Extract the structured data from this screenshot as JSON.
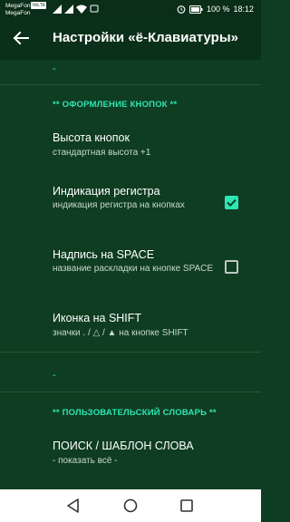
{
  "status_bar": {
    "carrier_1": "MegaFon",
    "carrier_1_badge": "VoLTE",
    "carrier_2": "MegaFon",
    "battery": "100 %",
    "time": "18:12"
  },
  "toolbar": {
    "title": "Настройки «ё-Клавиатуры»"
  },
  "content": {
    "top_dash": "-",
    "section_buttons": {
      "title": "** ОФОРМЛЕНИЕ КНОПОК **",
      "items": [
        {
          "title": "Высота кнопок",
          "summary": "стандартная высота +1"
        },
        {
          "title": "Индикация регистра",
          "summary": "индикация регистра на кнопках",
          "checked": true
        },
        {
          "title": "Надпись на SPACE",
          "summary": "название раскладки на кнопке SPACE",
          "checked": false
        },
        {
          "title": "Иконка на SHIFT",
          "summary": "значки . / △ / ▲ на кнопке SHIFT"
        }
      ]
    },
    "middle_dash": "-",
    "section_dictionary": {
      "title": "** ПОЛЬЗОВАТЕЛЬСКИЙ СЛОВАРЬ **",
      "items": [
        {
          "title": "ПОИСК / ШАБЛОН СЛОВА",
          "summary": "- показать всё -"
        }
      ]
    }
  },
  "colors": {
    "background": "#0f3d22",
    "toolbar": "#0b3019",
    "accent": "#2ee6b4",
    "divider": "#1f5a35"
  },
  "icons": [
    "back-arrow-icon",
    "signal-icon",
    "wifi-icon",
    "alarm-icon",
    "battery-icon",
    "nav-back-icon",
    "nav-home-icon",
    "nav-recents-icon",
    "checkbox-checked-icon"
  ]
}
